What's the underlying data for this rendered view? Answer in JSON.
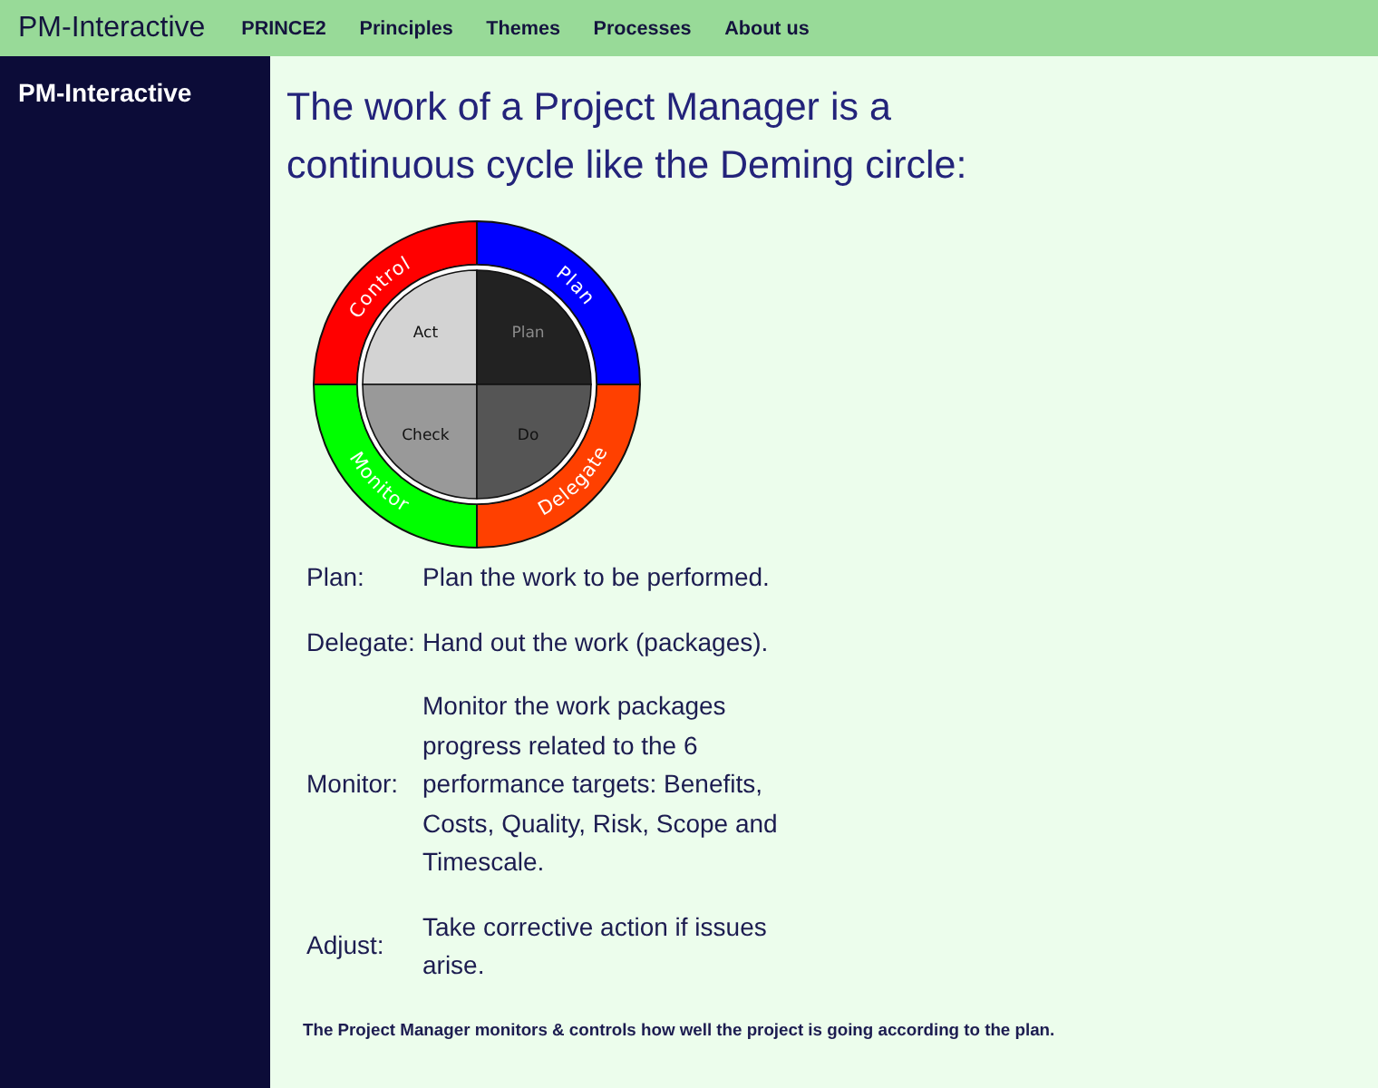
{
  "top_bar": {
    "brand": "PM-Interactive",
    "links": [
      "PRINCE2",
      "Principles",
      "Themes",
      "Processes",
      "About us"
    ]
  },
  "sidebar": {
    "title": "PM-Interactive"
  },
  "main": {
    "heading": "The work of a Project Manager is a continuous cycle like the Deming circle:",
    "cycle": {
      "outer_ring": [
        {
          "label": "Control",
          "color": "#ff0000"
        },
        {
          "label": "Plan",
          "color": "#0000ff"
        },
        {
          "label": "Monitor",
          "color": "#00ff00"
        },
        {
          "label": "Delegate",
          "color": "#ff4000"
        }
      ],
      "inner_circle": [
        {
          "label": "Act",
          "color": "#d3d3d3"
        },
        {
          "label": "Plan",
          "color": "#222222"
        },
        {
          "label": "Check",
          "color": "#999999"
        },
        {
          "label": "Do",
          "color": "#555555"
        }
      ]
    },
    "definitions": [
      {
        "term": "Plan:",
        "description": "Plan the work to be performed."
      },
      {
        "term": "Delegate:",
        "description": "Hand out the work (packages)."
      },
      {
        "term": "Monitor:",
        "description": "Monitor the work packages progress related to the 6 performance targets: Benefits, Costs, Quality, Risk, Scope and Timescale."
      },
      {
        "term": "Adjust:",
        "description": "Take corrective action if issues arise."
      }
    ],
    "footnote": "The Project Manager monitors & controls how well the project is going according to the plan."
  }
}
